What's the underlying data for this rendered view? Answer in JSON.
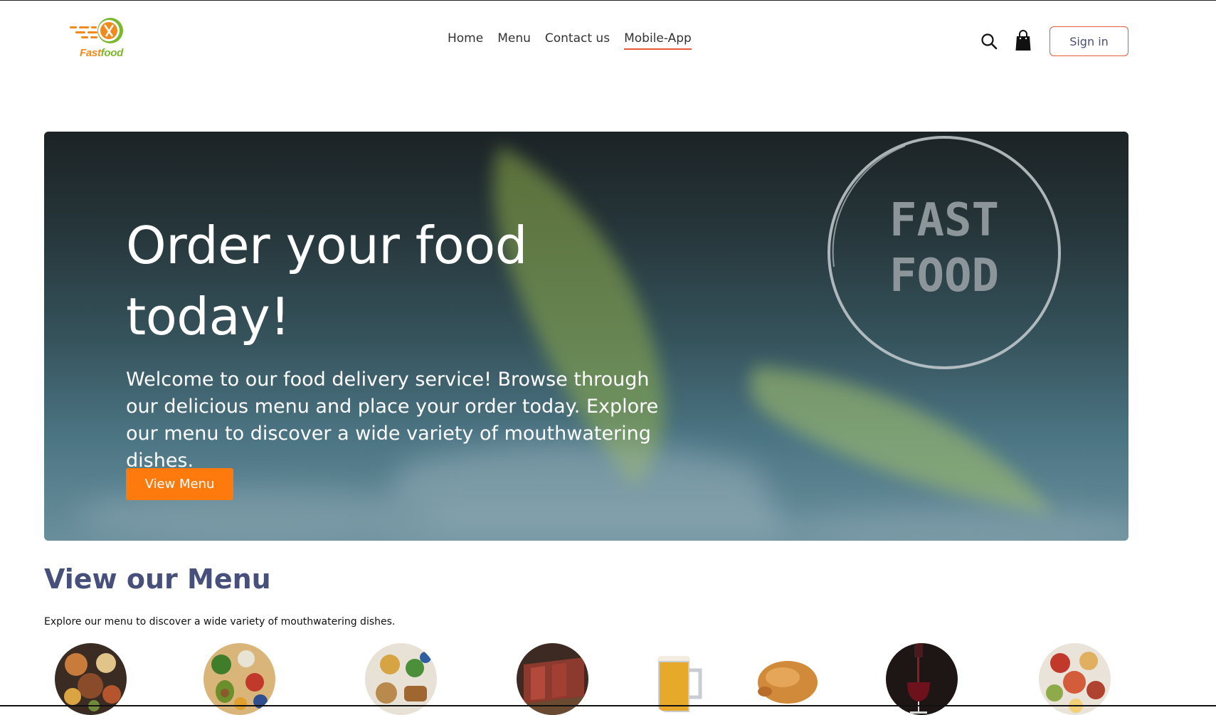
{
  "brand": {
    "logo_text_a": "Fast",
    "logo_text_b": "food",
    "accent": "#ff7a0c",
    "brand_orange": "#f08a1c",
    "brand_green": "#7cb82f"
  },
  "nav": {
    "items": [
      {
        "label": "Home"
      },
      {
        "label": "Menu"
      },
      {
        "label": "Contact us"
      },
      {
        "label": "Mobile-App",
        "active": true
      }
    ]
  },
  "header": {
    "signin_label": "Sign in",
    "search_icon": "search-icon",
    "cart_icon": "shopping-bag-icon"
  },
  "hero": {
    "title": "Order your food today!",
    "description": "Welcome to our food delivery service! Browse through our delicious menu and place your order today. Explore our menu to discover a wide variety of mouthwatering dishes.",
    "button_label": "View Menu",
    "badge_line1": "FAST",
    "badge_line2": "FOOD"
  },
  "menu_section": {
    "title": "View our Menu",
    "subtitle": "Explore our menu to discover a wide variety of mouthwatering dishes.",
    "categories": [
      {
        "icon": "mixed-dishes-image"
      },
      {
        "icon": "healthy-food-image"
      },
      {
        "icon": "bread-and-vegetables-image"
      },
      {
        "icon": "steak-image"
      },
      {
        "icon": "beer-mug-image"
      },
      {
        "icon": "roast-chicken-image"
      },
      {
        "icon": "red-wine-image"
      },
      {
        "icon": "table-dishes-image"
      }
    ]
  },
  "colors": {
    "signin_border": "#e8583a",
    "title_color": "#47507a"
  }
}
